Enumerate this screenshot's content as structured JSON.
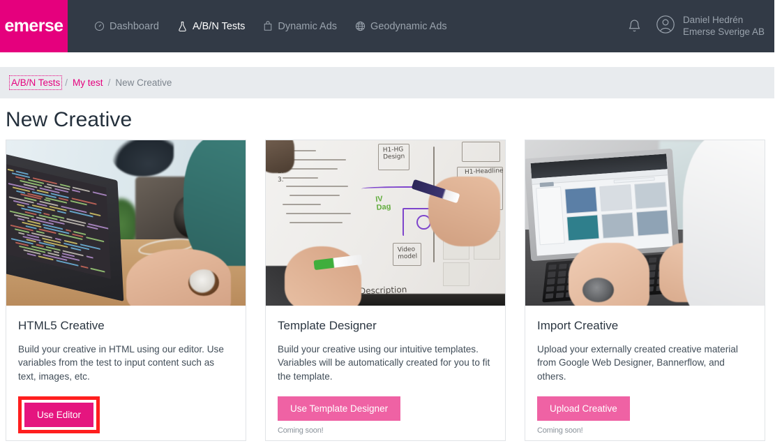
{
  "header": {
    "logo_text": "emerse",
    "nav_items": [
      {
        "label": "Dashboard",
        "icon": "gauge-icon",
        "active": false
      },
      {
        "label": "A/B/N Tests",
        "icon": "flask-icon",
        "active": true
      },
      {
        "label": "Dynamic Ads",
        "icon": "bag-icon",
        "active": false
      },
      {
        "label": "Geodynamic Ads",
        "icon": "globe-icon",
        "active": false
      }
    ],
    "notifications_icon": "bell-icon",
    "account_icon": "user-circle-icon",
    "user_name": "Daniel Hedrén",
    "user_company": "Emerse Sverige AB"
  },
  "breadcrumb": {
    "separator": "/",
    "items": [
      {
        "label": "A/B/N Tests",
        "current": false,
        "focused": true
      },
      {
        "label": "My test",
        "current": false,
        "focused": false
      },
      {
        "label": "New Creative",
        "current": true,
        "focused": false
      }
    ]
  },
  "page": {
    "title": "New Creative"
  },
  "cards": [
    {
      "image_alt": "person-typing-on-laptop-with-code-editor",
      "title": "HTML5 Creative",
      "description": "Build your creative in HTML using our editor. Use variables from the test to input content such as text, images, etc.",
      "button_label": "Use Editor",
      "button_style": "primary",
      "note": "",
      "highlighted": true
    },
    {
      "image_alt": "two-people-sketching-wireframes-on-whiteboard",
      "title": "Template Designer",
      "description": "Build your creative using our intuitive templates. Variables will be automatically created for you to fit the template.",
      "button_label": "Use Template Designer",
      "button_style": "muted",
      "note": "Coming soon!",
      "highlighted": false
    },
    {
      "image_alt": "person-using-laptop-browsing-marketplace",
      "title": "Import Creative",
      "description": "Upload your externally created creative material from Google Web Designer, Bannerflow, and others.",
      "button_label": "Upload Creative",
      "button_style": "muted",
      "note": "Coming soon!",
      "highlighted": false
    }
  ],
  "colors": {
    "brand_magenta": "#e5007d",
    "button_primary": "#e5157f",
    "button_muted": "#ef62a4",
    "nav_background": "#323a46",
    "breadcrumb_background": "#e8ebee",
    "highlight_annotation": "#ff1e1e",
    "text_dark": "#24303c",
    "text_muted": "#9aa3ad"
  }
}
